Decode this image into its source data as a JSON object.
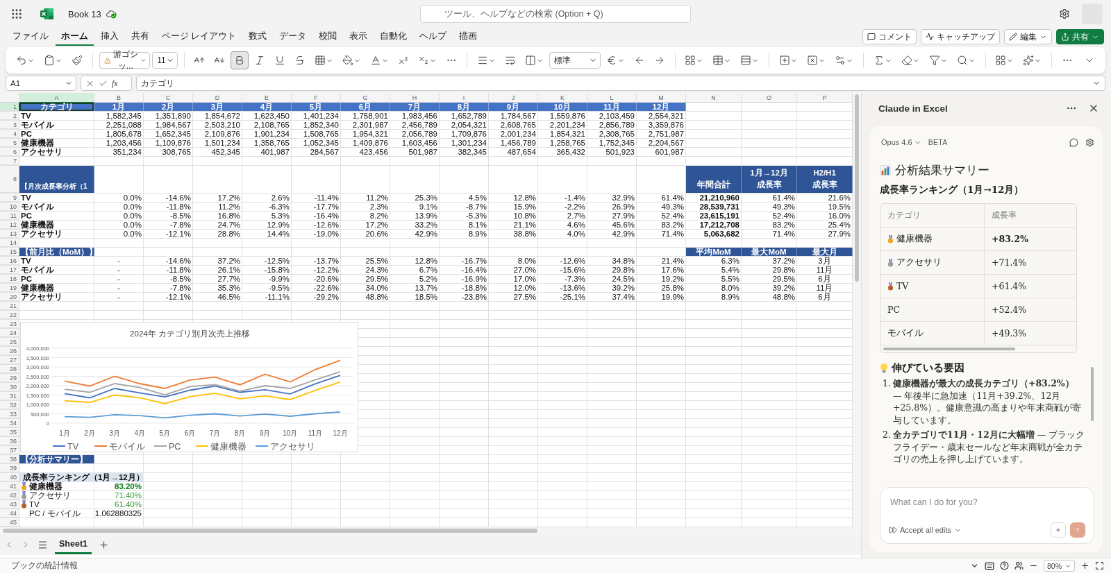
{
  "title_bar": {
    "document": "Book 13",
    "search_placeholder": "ツール、ヘルプなどの検索 (Option + Q)"
  },
  "menu_tabs": [
    {
      "label": "ファイル",
      "selected": false
    },
    {
      "label": "ホーム",
      "selected": true
    },
    {
      "label": "挿入",
      "selected": false
    },
    {
      "label": "共有",
      "selected": false
    },
    {
      "label": "ページ レイアウト",
      "selected": false
    },
    {
      "label": "数式",
      "selected": false
    },
    {
      "label": "データ",
      "selected": false
    },
    {
      "label": "校閲",
      "selected": false
    },
    {
      "label": "表示",
      "selected": false
    },
    {
      "label": "自動化",
      "selected": false
    },
    {
      "label": "ヘルプ",
      "selected": false
    },
    {
      "label": "描画",
      "selected": false
    }
  ],
  "header_buttons": [
    {
      "label": "コメント",
      "kind": "comment"
    },
    {
      "label": "キャッチアップ",
      "kind": "catchup"
    },
    {
      "label": "編集",
      "kind": "edit"
    },
    {
      "label": "共有",
      "kind": "share"
    }
  ],
  "ribbon": {
    "font": "游ゴシッ...",
    "font_size": "11",
    "bold_selected": true,
    "number_format": "標準"
  },
  "formula_bar": {
    "name_box": "A1",
    "function_label": "fx",
    "formula": "カテゴリ"
  },
  "columns": [
    {
      "label": "A",
      "selected": true
    },
    {
      "label": "B",
      "selected": false
    },
    {
      "label": "C",
      "selected": false
    },
    {
      "label": "D",
      "selected": false
    },
    {
      "label": "E",
      "selected": false
    },
    {
      "label": "F",
      "selected": false
    },
    {
      "label": "G",
      "selected": false
    },
    {
      "label": "H",
      "selected": false
    },
    {
      "label": "I",
      "selected": false
    },
    {
      "label": "J",
      "selected": false
    },
    {
      "label": "K",
      "selected": false
    },
    {
      "label": "L",
      "selected": false
    },
    {
      "label": "M",
      "selected": false
    },
    {
      "label": "N",
      "selected": false
    },
    {
      "label": "O",
      "selected": false
    },
    {
      "label": "P",
      "selected": false
    }
  ],
  "rows": [
    {
      "num": "1",
      "selected": true,
      "kind": "header",
      "label": "カテゴリ",
      "values": [
        "1月",
        "2月",
        "3月",
        "4月",
        "5月",
        "6月",
        "7月",
        "8月",
        "9月",
        "10月",
        "11月",
        "12月"
      ]
    },
    {
      "num": "2",
      "selected": false,
      "kind": "sales",
      "label": "TV",
      "values": [
        "1,582,345",
        "1,351,890",
        "1,854,672",
        "1,623,450",
        "1,401,234",
        "1,758,901",
        "1,983,456",
        "1,652,789",
        "1,784,567",
        "1,559,876",
        "2,103,459",
        "2,554,321"
      ]
    },
    {
      "num": "3",
      "selected": false,
      "kind": "sales",
      "label": "モバイル",
      "values": [
        "2,251,088",
        "1,984,567",
        "2,503,210",
        "2,108,765",
        "1,852,340",
        "2,301,987",
        "2,456,789",
        "2,054,321",
        "2,608,765",
        "2,201,234",
        "2,856,789",
        "3,359,876"
      ]
    },
    {
      "num": "4",
      "selected": false,
      "kind": "sales",
      "label": "PC",
      "values": [
        "1,805,678",
        "1,652,345",
        "2,109,876",
        "1,901,234",
        "1,508,765",
        "1,954,321",
        "2,056,789",
        "1,709,876",
        "2,001,234",
        "1,854,321",
        "2,308,765",
        "2,751,987"
      ]
    },
    {
      "num": "5",
      "selected": false,
      "kind": "sales",
      "label": "健康機器",
      "values": [
        "1,203,456",
        "1,109,876",
        "1,501,234",
        "1,358,765",
        "1,052,345",
        "1,409,876",
        "1,603,456",
        "1,301,234",
        "1,456,789",
        "1,258,765",
        "1,752,345",
        "2,204,567"
      ]
    },
    {
      "num": "6",
      "selected": false,
      "kind": "sales",
      "label": "アクセサリ",
      "values": [
        "351,234",
        "308,765",
        "452,345",
        "401,987",
        "284,567",
        "423,456",
        "501,987",
        "382,345",
        "487,654",
        "365,432",
        "501,923",
        "601,987"
      ]
    },
    {
      "num": "7",
      "selected": false,
      "kind": "blank"
    },
    {
      "num": "8",
      "selected": false,
      "kind": "section",
      "label": "【月次成長率分析（1",
      "extras": [
        {
          "lines": [
            "年間合計"
          ]
        },
        {
          "lines": [
            "1月→12月",
            "成長率"
          ]
        },
        {
          "lines": [
            "H2/H1",
            "成長率"
          ]
        }
      ]
    },
    {
      "num": "9",
      "selected": false,
      "kind": "growth",
      "label": "TV",
      "values": [
        "0.0%",
        "-14.6%",
        "17.2%",
        "2.6%",
        "-11.4%",
        "11.2%",
        "25.3%",
        "4.5%",
        "12.8%",
        "-1.4%",
        "32.9%",
        "61.4%"
      ],
      "extras": [
        "21,210,960",
        "61.4%",
        "21.6%"
      ]
    },
    {
      "num": "10",
      "selected": false,
      "kind": "growth",
      "label": "モバイル",
      "values": [
        "0.0%",
        "-11.8%",
        "11.2%",
        "-6.3%",
        "-17.7%",
        "2.3%",
        "9.1%",
        "-8.7%",
        "15.9%",
        "-2.2%",
        "26.9%",
        "49.3%"
      ],
      "extras": [
        "28,539,731",
        "49.3%",
        "19.5%"
      ]
    },
    {
      "num": "11",
      "selected": false,
      "kind": "growth",
      "label": "PC",
      "values": [
        "0.0%",
        "-8.5%",
        "16.8%",
        "5.3%",
        "-16.4%",
        "8.2%",
        "13.9%",
        "-5.3%",
        "10.8%",
        "2.7%",
        "27.9%",
        "52.4%"
      ],
      "extras": [
        "23,615,191",
        "52.4%",
        "16.0%"
      ]
    },
    {
      "num": "12",
      "selected": false,
      "kind": "growth",
      "label": "健康機器",
      "values": [
        "0.0%",
        "-7.8%",
        "24.7%",
        "12.9%",
        "-12.6%",
        "17.2%",
        "33.2%",
        "8.1%",
        "21.1%",
        "4.6%",
        "45.6%",
        "83.2%"
      ],
      "extras": [
        "17,212,708",
        "83.2%",
        "25.4%"
      ]
    },
    {
      "num": "13",
      "selected": false,
      "kind": "growth",
      "label": "アクセサリ",
      "values": [
        "0.0%",
        "-12.1%",
        "28.8%",
        "14.4%",
        "-19.0%",
        "20.6%",
        "42.9%",
        "8.9%",
        "38.8%",
        "4.0%",
        "42.9%",
        "71.4%"
      ],
      "extras": [
        "5,063,682",
        "71.4%",
        "27.9%"
      ]
    },
    {
      "num": "14",
      "selected": false,
      "kind": "blank"
    },
    {
      "num": "15",
      "selected": false,
      "kind": "section",
      "label": "【前月比（MoM）】",
      "extras": [
        {
          "lines": [
            "平均MoM"
          ]
        },
        {
          "lines": [
            "最大MoM"
          ]
        },
        {
          "lines": [
            "最大月"
          ]
        }
      ]
    },
    {
      "num": "16",
      "selected": false,
      "kind": "mom",
      "label": "TV",
      "values": [
        "-",
        "-14.6%",
        "37.2%",
        "-12.5%",
        "-13.7%",
        "25.5%",
        "12.8%",
        "-16.7%",
        "8.0%",
        "-12.6%",
        "34.8%",
        "21.4%"
      ],
      "extras": [
        "6.3%",
        "37.2%",
        "3月"
      ]
    },
    {
      "num": "17",
      "selected": false,
      "kind": "mom",
      "label": "モバイル",
      "values": [
        "-",
        "-11.8%",
        "26.1%",
        "-15.8%",
        "-12.2%",
        "24.3%",
        "6.7%",
        "-16.4%",
        "27.0%",
        "-15.6%",
        "29.8%",
        "17.6%"
      ],
      "extras": [
        "5.4%",
        "29.8%",
        "11月"
      ]
    },
    {
      "num": "18",
      "selected": false,
      "kind": "mom",
      "label": "PC",
      "values": [
        "-",
        "-8.5%",
        "27.7%",
        "-9.9%",
        "-20.6%",
        "29.5%",
        "5.2%",
        "-16.9%",
        "17.0%",
        "-7.3%",
        "24.5%",
        "19.2%"
      ],
      "extras": [
        "5.5%",
        "29.5%",
        "6月"
      ]
    },
    {
      "num": "19",
      "selected": false,
      "kind": "mom",
      "label": "健康機器",
      "values": [
        "-",
        "-7.8%",
        "35.3%",
        "-9.5%",
        "-22.6%",
        "34.0%",
        "13.7%",
        "-18.8%",
        "12.0%",
        "-13.6%",
        "39.2%",
        "25.8%"
      ],
      "extras": [
        "8.0%",
        "39.2%",
        "11月"
      ]
    },
    {
      "num": "20",
      "selected": false,
      "kind": "mom",
      "label": "アクセサリ",
      "values": [
        "-",
        "-12.1%",
        "46.5%",
        "-11.1%",
        "-29.2%",
        "48.8%",
        "18.5%",
        "-23.8%",
        "27.5%",
        "-25.1%",
        "37.4%",
        "19.9%"
      ],
      "extras": [
        "8.9%",
        "48.8%",
        "6月"
      ]
    },
    {
      "num": "21",
      "selected": false,
      "kind": "blank"
    },
    {
      "num": "22",
      "selected": false,
      "kind": "blank"
    },
    {
      "num": "23",
      "selected": false,
      "kind": "blank"
    },
    {
      "num": "24",
      "selected": false,
      "kind": "blank"
    },
    {
      "num": "25",
      "selected": false,
      "kind": "blank"
    },
    {
      "num": "26",
      "selected": false,
      "kind": "blank"
    },
    {
      "num": "27",
      "selected": false,
      "kind": "blank"
    },
    {
      "num": "28",
      "selected": false,
      "kind": "blank"
    },
    {
      "num": "29",
      "selected": false,
      "kind": "blank"
    },
    {
      "num": "30",
      "selected": false,
      "kind": "blank"
    },
    {
      "num": "31",
      "selected": false,
      "kind": "blank"
    },
    {
      "num": "32",
      "selected": false,
      "kind": "blank"
    },
    {
      "num": "33",
      "selected": false,
      "kind": "blank"
    },
    {
      "num": "34",
      "selected": false,
      "kind": "blank"
    },
    {
      "num": "35",
      "selected": false,
      "kind": "blank"
    },
    {
      "num": "36",
      "selected": false,
      "kind": "blank"
    },
    {
      "num": "37",
      "selected": false,
      "kind": "blank"
    },
    {
      "num": "38",
      "selected": false,
      "kind": "section",
      "label": "【分析サマリー】"
    },
    {
      "num": "39",
      "selected": false,
      "kind": "blank"
    },
    {
      "num": "40",
      "selected": false,
      "kind": "rank_title",
      "label": "成長率ランキング（1月→12月）"
    },
    {
      "num": "41",
      "selected": false,
      "kind": "rank",
      "label": "健康機器",
      "value": "83.20%",
      "color": "#e9a91a",
      "emphasis": true
    },
    {
      "num": "42",
      "selected": false,
      "kind": "rank",
      "label": "アクセサリ",
      "value": "71.40%",
      "color": "#9e9e9e",
      "emphasis": false
    },
    {
      "num": "43",
      "selected": false,
      "kind": "rank",
      "label": "TV",
      "value": "61.40%",
      "color": "#b8602a",
      "emphasis": false
    },
    {
      "num": "44",
      "selected": false,
      "kind": "ratio",
      "label": "PC / モバイル",
      "value": "1.062880325"
    },
    {
      "num": "45",
      "selected": false,
      "kind": "blank"
    }
  ],
  "chart_data": {
    "type": "line",
    "title": "2024年 カテゴリ別月次売上推移",
    "categories": [
      "1月",
      "2月",
      "3月",
      "4月",
      "5月",
      "6月",
      "7月",
      "8月",
      "9月",
      "10月",
      "11月",
      "12月"
    ],
    "series": [
      {
        "name": "TV",
        "color": "#4472c4",
        "values": [
          1580000,
          1350000,
          1850000,
          1620000,
          1400000,
          1760000,
          1980000,
          1650000,
          1780000,
          1560000,
          2100000,
          2550000
        ]
      },
      {
        "name": "モバイル",
        "color": "#ed7d31",
        "values": [
          2250000,
          1980000,
          2500000,
          2110000,
          1850000,
          2300000,
          2460000,
          2050000,
          2610000,
          2200000,
          2860000,
          3360000
        ]
      },
      {
        "name": "PC",
        "color": "#a5a5a5",
        "values": [
          1810000,
          1650000,
          2110000,
          1900000,
          1510000,
          1950000,
          2060000,
          1710000,
          2000000,
          1850000,
          2310000,
          2750000
        ]
      },
      {
        "name": "健康機器",
        "color": "#ffc000",
        "values": [
          1200000,
          1110000,
          1500000,
          1360000,
          1050000,
          1410000,
          1600000,
          1300000,
          1460000,
          1260000,
          1750000,
          2200000
        ]
      },
      {
        "name": "アクセサリ",
        "color": "#5b9bd5",
        "values": [
          350000,
          310000,
          450000,
          400000,
          280000,
          420000,
          500000,
          380000,
          490000,
          370000,
          500000,
          600000
        ]
      }
    ],
    "grid": true,
    "legend": true,
    "ylim": [
      0,
      4000000
    ],
    "yticks": [
      {
        "value": 0,
        "label": "0"
      },
      {
        "value": 500000,
        "label": "500,000"
      },
      {
        "value": 1000000,
        "label": "1,000,000"
      },
      {
        "value": 1500000,
        "label": "1,500,000"
      },
      {
        "value": 2000000,
        "label": "2,000,000"
      },
      {
        "value": 2500000,
        "label": "2,500,000"
      },
      {
        "value": 3000000,
        "label": "3,000,000"
      },
      {
        "value": 3500000,
        "label": "3,500,000"
      },
      {
        "value": 4000000,
        "label": "4,000,000"
      }
    ]
  },
  "sheet_tabs": [
    {
      "label": "Sheet1",
      "selected": true
    }
  ],
  "status_bar": {
    "text": "ブックの統計情報",
    "zoom": "80%"
  },
  "assistant_panel": {
    "title": "Claude in Excel",
    "model": "Opus 4.6",
    "badge": "BETA",
    "heading": "分析結果サマリー",
    "subheading": "成長率ランキング（1月→12月）",
    "table": {
      "columns": [
        "カテゴリ",
        "成長率"
      ],
      "rows": [
        {
          "category": "健康機器",
          "rate": "+83.2%",
          "color": "#e9a91a",
          "emphasis": true
        },
        {
          "category": "アクセサリ",
          "rate": "+71.4%",
          "color": "#9e9e9e",
          "emphasis": false
        },
        {
          "category": "TV",
          "rate": "+61.4%",
          "color": "#b8602a",
          "emphasis": false
        },
        {
          "category": "PC",
          "rate": "+52.4%",
          "emphasis": false
        },
        {
          "category": "モバイル",
          "rate": "+49.3%",
          "emphasis": false
        }
      ]
    },
    "factors_heading": "伸びている要因",
    "factors": [
      {
        "number": "1.",
        "text": "**健康機器が最大の成長カテゴリ（+83.2%）** — 年後半に急加速（11月+39.2%、12月+25.8%）。健康意識の高まりや年末商戦が寄与しています。"
      },
      {
        "number": "2.",
        "text": "**全カテゴリで11月・12月に大幅増** — ブラックフライデー・歳末セールなど年末商戦が全カテゴリの売上を押し上げています。"
      }
    ],
    "input_placeholder": "What can I do for you?",
    "accept_label": "Accept all edits"
  }
}
